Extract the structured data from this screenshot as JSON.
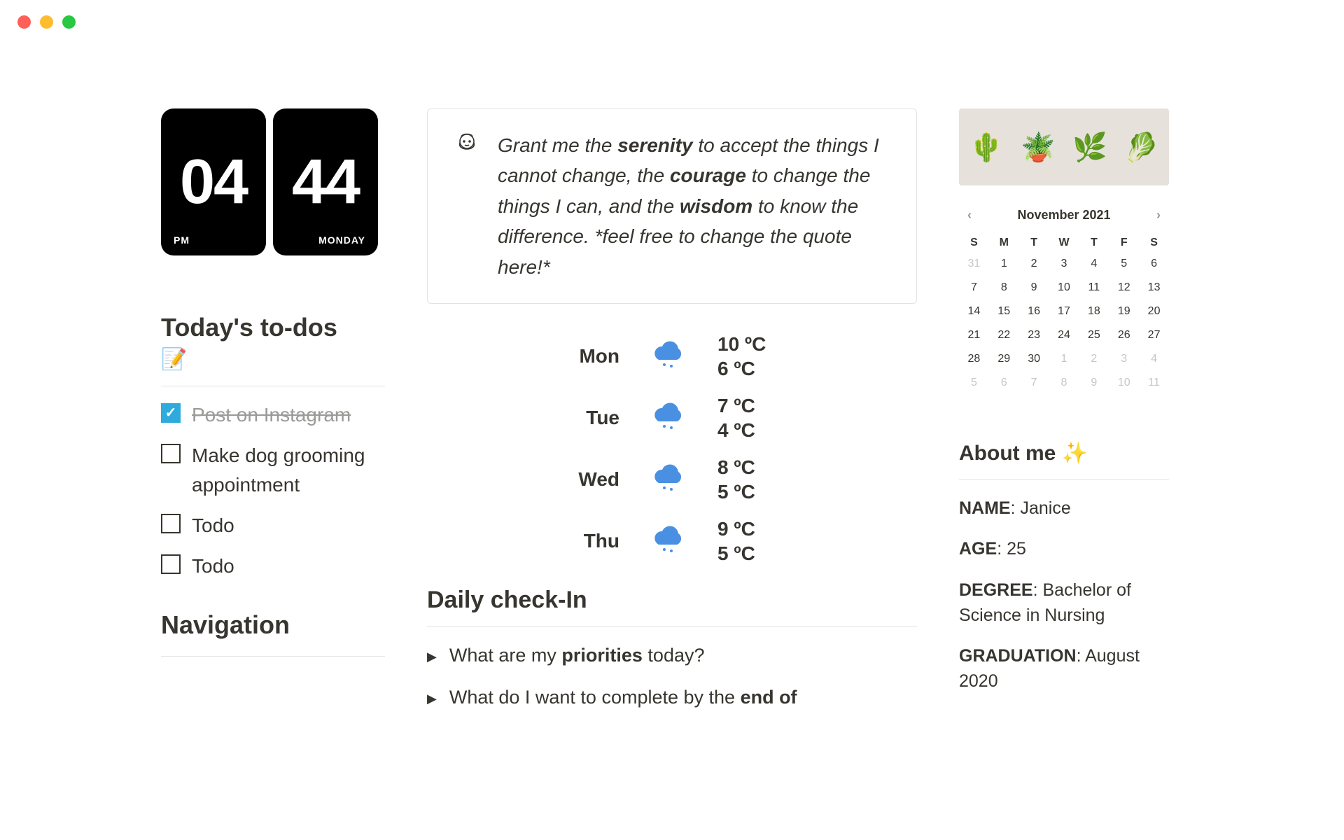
{
  "clock": {
    "hour": "04",
    "minute": "44",
    "meridiem": "PM",
    "day": "MONDAY"
  },
  "todos": {
    "heading": "Today's to-dos",
    "emoji": "📝",
    "items": [
      {
        "text": "Post on Instagram",
        "done": true
      },
      {
        "text": "Make dog grooming appointment",
        "done": false
      },
      {
        "text": "Todo",
        "done": false
      },
      {
        "text": "Todo",
        "done": false
      }
    ]
  },
  "navigation": {
    "heading": "Navigation"
  },
  "quote": {
    "pre1": "Grant me the ",
    "b1": "serenity",
    "mid1": " to accept the things I cannot change, the ",
    "b2": "courage",
    "mid2": " to change the things I can, and the ",
    "b3": "wisdom",
    "post": " to know the difference. *feel free to change the quote here!*"
  },
  "weather": [
    {
      "day": "Mon",
      "hi": "10 ºC",
      "lo": "6 ºC"
    },
    {
      "day": "Tue",
      "hi": "7 ºC",
      "lo": "4 ºC"
    },
    {
      "day": "Wed",
      "hi": "8 ºC",
      "lo": "5 ºC"
    },
    {
      "day": "Thu",
      "hi": "9 ºC",
      "lo": "5 ºC"
    }
  ],
  "checkin": {
    "heading": "Daily check-In",
    "q1_pre": "What are my ",
    "q1_b": "priorities",
    "q1_post": " today?",
    "q2_pre": "What do I want to complete by the ",
    "q2_b": "end of",
    "q2_post": ""
  },
  "calendar": {
    "month": "November 2021",
    "dow": [
      "S",
      "M",
      "T",
      "W",
      "T",
      "F",
      "S"
    ],
    "weeks": [
      [
        {
          "n": "31",
          "muted": true
        },
        {
          "n": "1"
        },
        {
          "n": "2"
        },
        {
          "n": "3"
        },
        {
          "n": "4"
        },
        {
          "n": "5"
        },
        {
          "n": "6"
        }
      ],
      [
        {
          "n": "7"
        },
        {
          "n": "8"
        },
        {
          "n": "9"
        },
        {
          "n": "10"
        },
        {
          "n": "11"
        },
        {
          "n": "12"
        },
        {
          "n": "13"
        }
      ],
      [
        {
          "n": "14"
        },
        {
          "n": "15"
        },
        {
          "n": "16"
        },
        {
          "n": "17"
        },
        {
          "n": "18"
        },
        {
          "n": "19"
        },
        {
          "n": "20"
        }
      ],
      [
        {
          "n": "21"
        },
        {
          "n": "22"
        },
        {
          "n": "23"
        },
        {
          "n": "24"
        },
        {
          "n": "25"
        },
        {
          "n": "26"
        },
        {
          "n": "27"
        }
      ],
      [
        {
          "n": "28"
        },
        {
          "n": "29"
        },
        {
          "n": "30"
        },
        {
          "n": "1",
          "muted": true
        },
        {
          "n": "2",
          "muted": true
        },
        {
          "n": "3",
          "muted": true
        },
        {
          "n": "4",
          "muted": true
        }
      ],
      [
        {
          "n": "5",
          "muted": true
        },
        {
          "n": "6",
          "muted": true
        },
        {
          "n": "7",
          "muted": true
        },
        {
          "n": "8",
          "muted": true
        },
        {
          "n": "9",
          "muted": true
        },
        {
          "n": "10",
          "muted": true
        },
        {
          "n": "11",
          "muted": true
        }
      ]
    ]
  },
  "about": {
    "heading": "About me ✨",
    "name_label": "NAME",
    "name_val": ": Janice",
    "age_label": "AGE",
    "age_val": ": 25",
    "degree_label": "DEGREE",
    "degree_val": ": Bachelor of Science in Nursing",
    "grad_label": "GRADUATION",
    "grad_val": ": August 2020"
  }
}
